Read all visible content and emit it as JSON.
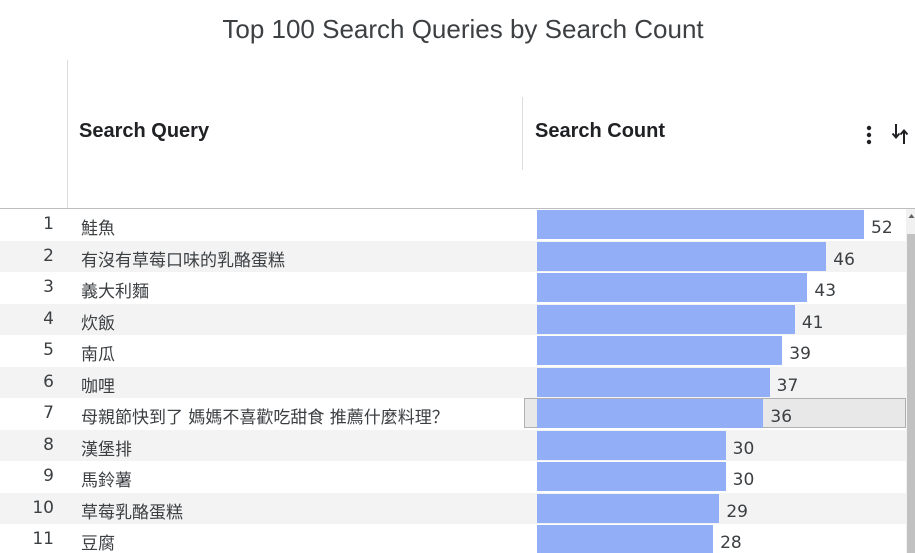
{
  "title": "Top 100 Search Queries by Search Count",
  "columns": {
    "query": "Search Query",
    "count": "Search Count"
  },
  "icons": {
    "menu": "kebab-menu-icon",
    "sort": "sort-arrows-icon"
  },
  "colors": {
    "bar": "#92aef6",
    "row_alt": "#f3f3f3"
  },
  "chart_data": {
    "type": "bar",
    "orientation": "horizontal",
    "title": "Top 100 Search Queries by Search Count",
    "xlabel": "Search Count",
    "ylabel": "Search Query",
    "xlim": [
      0,
      52
    ],
    "grid": false,
    "highlighted_row": 7,
    "indices": [
      1,
      2,
      3,
      4,
      5,
      6,
      7,
      8,
      9,
      10,
      11
    ],
    "categories": [
      "鮭魚",
      "有沒有草莓口味的乳酪蛋糕",
      "義大利麵",
      "炊飯",
      "南瓜",
      "咖哩",
      "母親節快到了 媽媽不喜歡吃甜食 推薦什麼料理？",
      "漢堡排",
      "馬鈴薯",
      "草莓乳酪蛋糕",
      "豆腐"
    ],
    "values": [
      52,
      46,
      43,
      41,
      39,
      37,
      36,
      30,
      30,
      29,
      28
    ]
  }
}
